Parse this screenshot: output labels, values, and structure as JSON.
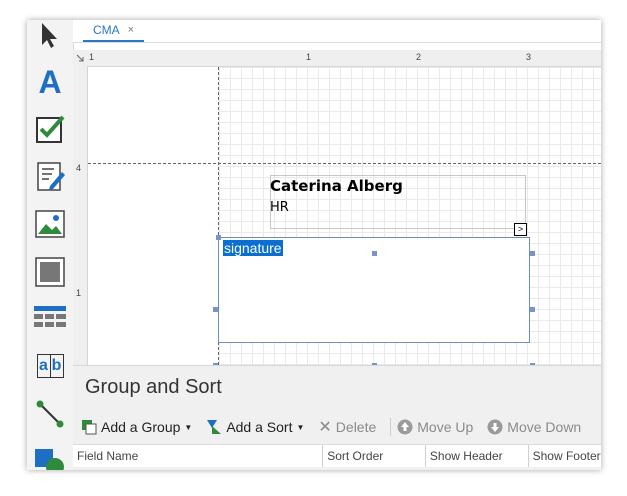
{
  "document_tab": {
    "label": "CMA",
    "close": "×"
  },
  "toolbox": {
    "items": [
      "pointer-icon",
      "label-icon",
      "checkbox-icon",
      "richtext-icon",
      "picture-icon",
      "panel-icon",
      "table-icon",
      "character-comb-icon",
      "line-icon",
      "shape-icon"
    ],
    "label_glyph": "A",
    "comb_glyph_a": "a",
    "comb_glyph_b": "b"
  },
  "ruler": {
    "h_ticks": [
      "1",
      "1",
      "2",
      "3"
    ],
    "v_ticks": [
      "4",
      "1"
    ]
  },
  "canvas": {
    "contact_name": "Caterina Alberg",
    "contact_dept": "HR",
    "smart_tag": ">",
    "signature_text": "signature"
  },
  "group_sort": {
    "title": "Group and Sort",
    "toolbar": {
      "add_group": "Add a Group",
      "add_sort": "Add a Sort",
      "delete": "Delete",
      "move_up": "Move Up",
      "move_down": "Move Down"
    },
    "columns": [
      "Field Name",
      "Sort Order",
      "Show Header",
      "Show Footer"
    ]
  },
  "colors": {
    "accent": "#2b78c5",
    "selection": "#0b6fd0",
    "toolbox_icon": "#1e6fc4",
    "checkbox_green": "#2e8b3c"
  }
}
